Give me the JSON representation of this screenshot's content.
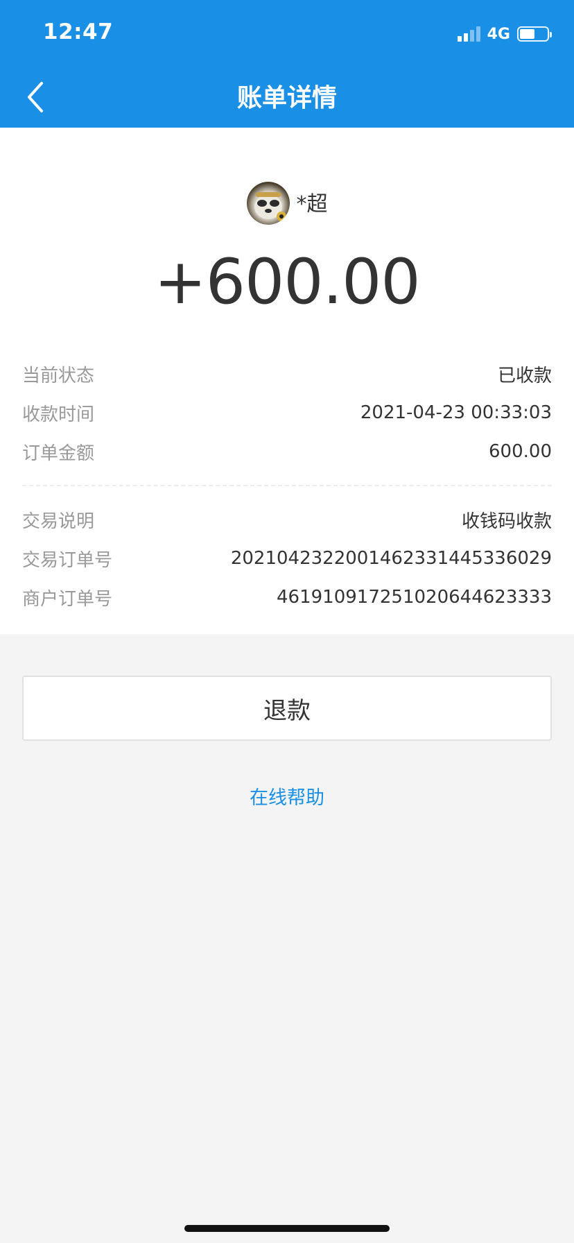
{
  "status_bar": {
    "time": "12:47",
    "network": "4G",
    "signal_bars": 2,
    "battery_level": 0.55
  },
  "nav": {
    "title": "账单详情",
    "back_icon": "chevron-left-icon"
  },
  "payer": {
    "name": "*超",
    "avatar_icon": "panda-avatar"
  },
  "amount": "+600.00",
  "details_primary": [
    {
      "label": "当前状态",
      "value": "已收款"
    },
    {
      "label": "收款时间",
      "value": "2021-04-23 00:33:03"
    },
    {
      "label": "订单金额",
      "value": "600.00"
    }
  ],
  "details_secondary": [
    {
      "label": "交易说明",
      "value": "收钱码收款"
    },
    {
      "label": "交易订单号",
      "value": "2021042322001462331445336029"
    },
    {
      "label": "商户订单号",
      "value": "461910917251020644623333"
    }
  ],
  "actions": {
    "refund_label": "退款",
    "help_label": "在线帮助"
  },
  "colors": {
    "brand": "#1a8fe6",
    "background": "#f4f4f4",
    "card": "#ffffff",
    "label_gray": "#999999",
    "text": "#333333"
  }
}
